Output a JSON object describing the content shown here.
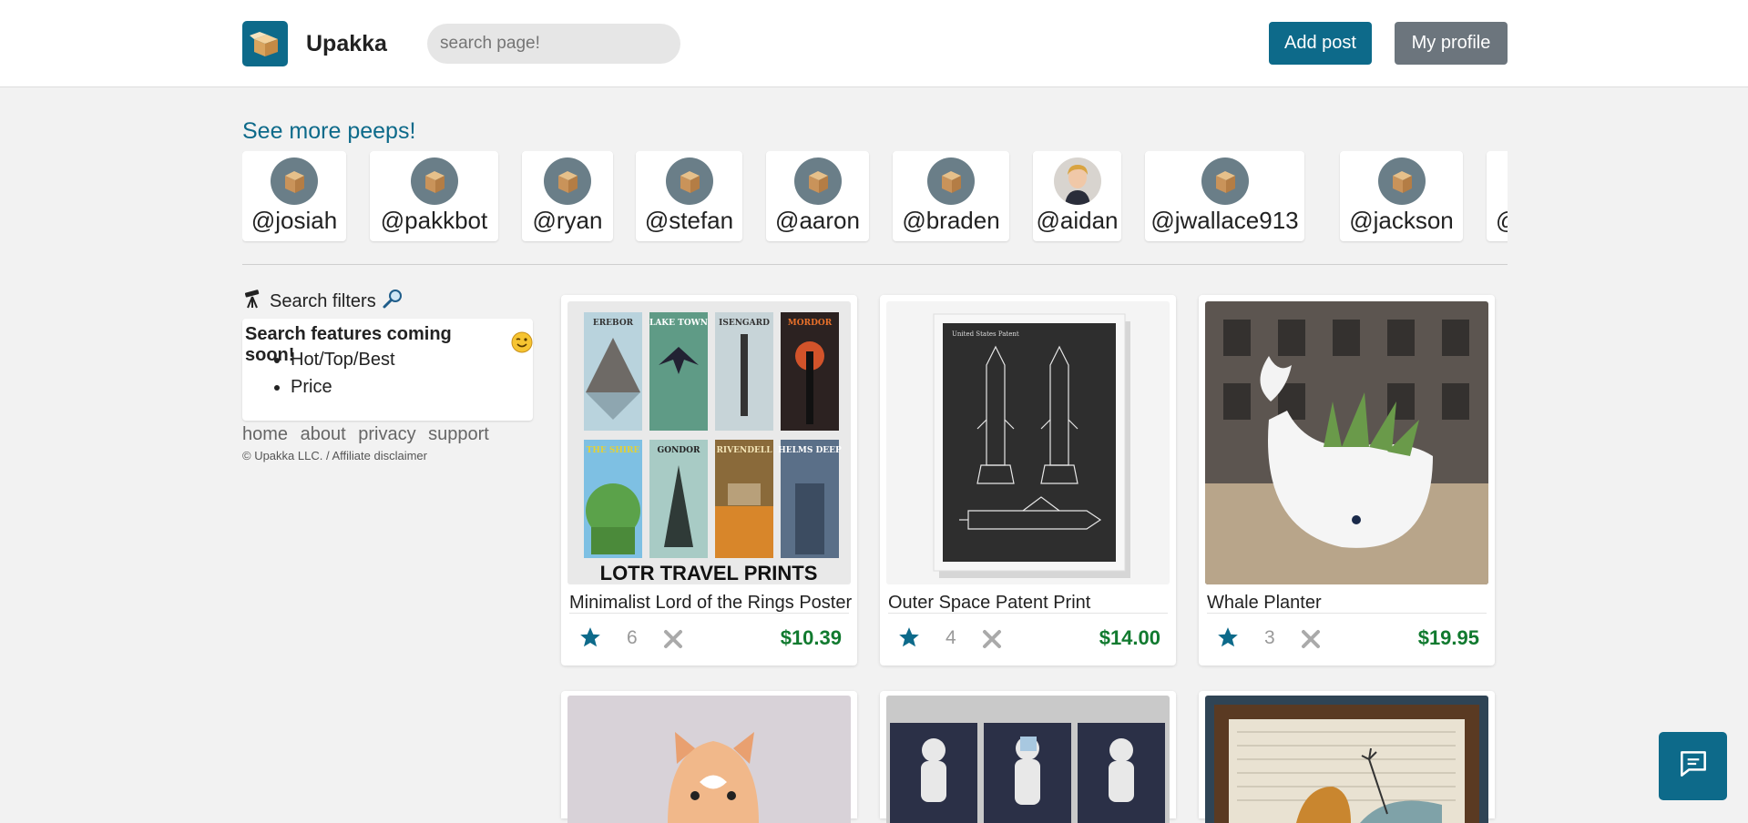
{
  "header": {
    "brand": "Upakka",
    "search_placeholder": "search page!",
    "add_post_label": "Add post",
    "my_profile_label": "My profile"
  },
  "peeps": {
    "title": "See more peeps!",
    "users": [
      "@josiah",
      "@pakkbot",
      "@ryan",
      "@stefan",
      "@aaron",
      "@braden",
      "@aidan",
      "@jwallace913",
      "@jackson",
      "@"
    ]
  },
  "sidebar": {
    "filters_title": "Search filters",
    "coming_soon": "Search features coming soon!",
    "features": [
      "Hot/Top/Best",
      "Price"
    ],
    "links": [
      "home",
      "about",
      "privacy",
      "support"
    ],
    "copyright": "© Upakka LLC. / Affiliate disclaimer"
  },
  "posts": [
    {
      "title": "Minimalist Lord of the Rings Poster",
      "count": "6",
      "price": "$10.39",
      "image_caption": "LOTR TRAVEL PRINTS",
      "poster_names": [
        "EREBOR",
        "LAKE TOWN",
        "ISENGARD",
        "MORDOR",
        "THE SHIRE",
        "GONDOR",
        "RIVENDELL",
        "HELMS DEEP"
      ]
    },
    {
      "title": "Outer Space Patent Print",
      "count": "4",
      "price": "$14.00",
      "patent_header": "United States Patent"
    },
    {
      "title": "Whale Planter",
      "count": "3",
      "price": "$19.95"
    }
  ],
  "colors": {
    "accent": "#0d6a8a",
    "price": "#117a2f",
    "secondary": "#6c757d"
  }
}
